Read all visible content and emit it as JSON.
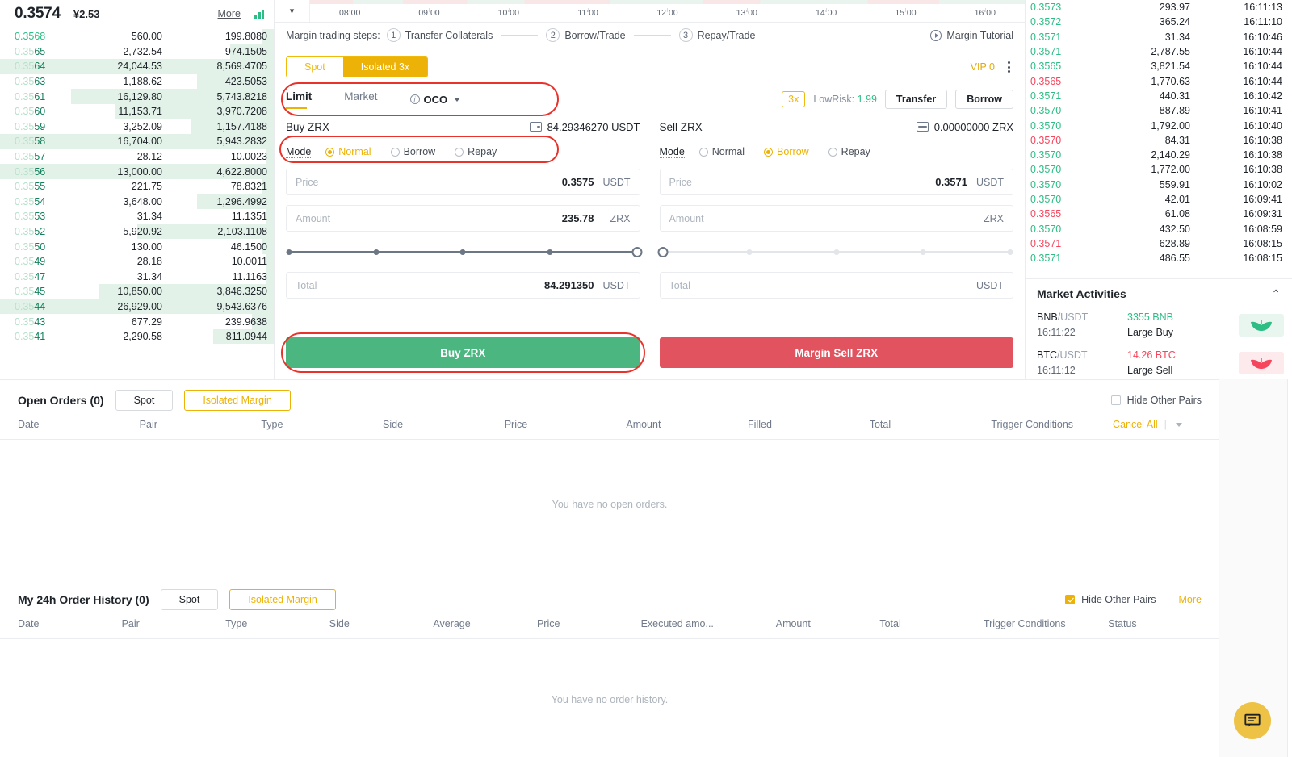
{
  "orderbook": {
    "last_price": "0.3574",
    "fiat_price": "¥2.53",
    "more_label": "More",
    "rows": [
      {
        "price": "0.3568",
        "sig": "",
        "amount": "560.00",
        "total": "199.8080",
        "bar": 4,
        "dim": false
      },
      {
        "price": "0.3565",
        "sig": "65",
        "amount": "2,732.54",
        "total": "974.1505",
        "bar": 16,
        "dim": true
      },
      {
        "price": "0.3564",
        "sig": "64",
        "amount": "24,044.53",
        "total": "8,569.4705",
        "bar": 100,
        "dim": true
      },
      {
        "price": "0.3563",
        "sig": "63",
        "amount": "1,188.62",
        "total": "423.5053",
        "bar": 28,
        "dim": true
      },
      {
        "price": "0.3561",
        "sig": "61",
        "amount": "16,129.80",
        "total": "5,743.8218",
        "bar": 74,
        "dim": true
      },
      {
        "price": "0.3560",
        "sig": "60",
        "amount": "11,153.71",
        "total": "3,970.7208",
        "bar": 58,
        "dim": true
      },
      {
        "price": "0.3559",
        "sig": "59",
        "amount": "3,252.09",
        "total": "1,157.4188",
        "bar": 30,
        "dim": true
      },
      {
        "price": "0.3558",
        "sig": "58",
        "amount": "16,704.00",
        "total": "5,943.2832",
        "bar": 100,
        "dim": true
      },
      {
        "price": "0.3557",
        "sig": "57",
        "amount": "28.12",
        "total": "10.0023",
        "bar": 3,
        "dim": true
      },
      {
        "price": "0.3556",
        "sig": "56",
        "amount": "13,000.00",
        "total": "4,622.8000",
        "bar": 100,
        "dim": true
      },
      {
        "price": "0.3555",
        "sig": "55",
        "amount": "221.75",
        "total": "78.8321",
        "bar": 4,
        "dim": true
      },
      {
        "price": "0.3554",
        "sig": "54",
        "amount": "3,648.00",
        "total": "1,296.4992",
        "bar": 28,
        "dim": true
      },
      {
        "price": "0.3553",
        "sig": "53",
        "amount": "31.34",
        "total": "11.1351",
        "bar": 3,
        "dim": true
      },
      {
        "price": "0.3552",
        "sig": "52",
        "amount": "5,920.92",
        "total": "2,103.1108",
        "bar": 50,
        "dim": true
      },
      {
        "price": "0.3550",
        "sig": "50",
        "amount": "130.00",
        "total": "46.1500",
        "bar": 4,
        "dim": true
      },
      {
        "price": "0.3549",
        "sig": "49",
        "amount": "28.18",
        "total": "10.0011",
        "bar": 3,
        "dim": true
      },
      {
        "price": "0.3547",
        "sig": "47",
        "amount": "31.34",
        "total": "11.1163",
        "bar": 3,
        "dim": true
      },
      {
        "price": "0.3545",
        "sig": "45",
        "amount": "10,850.00",
        "total": "3,846.3250",
        "bar": 64,
        "dim": true
      },
      {
        "price": "0.3544",
        "sig": "44",
        "amount": "26,929.00",
        "total": "9,543.6376",
        "bar": 100,
        "dim": true
      },
      {
        "price": "0.3543",
        "sig": "43",
        "amount": "677.29",
        "total": "239.9638",
        "bar": 8,
        "dim": true
      },
      {
        "price": "0.3541",
        "sig": "41",
        "amount": "2,290.58",
        "total": "811.0944",
        "bar": 22,
        "dim": true
      }
    ]
  },
  "chart": {
    "ticks": [
      "08:00",
      "09:00",
      "10:00",
      "11:00",
      "12:00",
      "13:00",
      "14:00",
      "15:00",
      "16:00"
    ]
  },
  "steps": {
    "label": "Margin trading steps:",
    "items": [
      {
        "num": "1",
        "text": "Transfer Collaterals"
      },
      {
        "num": "2",
        "text": "Borrow/Trade"
      },
      {
        "num": "3",
        "text": "Repay/Trade"
      }
    ],
    "tutorial": "Margin Tutorial"
  },
  "market_mode": {
    "spot": "Spot",
    "isolated": "Isolated 3x",
    "vip": "VIP 0"
  },
  "order_type": {
    "limit": "Limit",
    "market": "Market",
    "oco": "OCO",
    "leverage": "3x",
    "risk_label": "LowRisk:",
    "risk_value": "1.99",
    "transfer": "Transfer",
    "borrow": "Borrow"
  },
  "buy": {
    "title": "Buy ZRX",
    "balance": "84.29346270 USDT",
    "mode_label": "Mode",
    "modes": [
      {
        "label": "Normal",
        "selected": true
      },
      {
        "label": "Borrow",
        "selected": false
      },
      {
        "label": "Repay",
        "selected": false
      }
    ],
    "price_placeholder": "Price",
    "price_value": "0.3575",
    "price_unit": "USDT",
    "amount_placeholder": "Amount",
    "amount_value": "235.78",
    "amount_unit": "ZRX",
    "total_placeholder": "Total",
    "total_value": "84.291350",
    "total_unit": "USDT",
    "slider_percent": 100,
    "submit": "Buy ZRX"
  },
  "sell": {
    "title": "Sell ZRX",
    "balance": "0.00000000 ZRX",
    "mode_label": "Mode",
    "modes": [
      {
        "label": "Normal",
        "selected": false
      },
      {
        "label": "Borrow",
        "selected": true
      },
      {
        "label": "Repay",
        "selected": false
      }
    ],
    "price_placeholder": "Price",
    "price_value": "0.3571",
    "price_unit": "USDT",
    "amount_placeholder": "Amount",
    "amount_value": "",
    "amount_unit": "ZRX",
    "total_placeholder": "Total",
    "total_value": "",
    "total_unit": "USDT",
    "slider_percent": 0,
    "submit": "Margin Sell ZRX"
  },
  "trades": [
    {
      "price": "0.3573",
      "dir": "up",
      "amount": "293.97",
      "time": "16:11:13"
    },
    {
      "price": "0.3572",
      "dir": "up",
      "amount": "365.24",
      "time": "16:11:10"
    },
    {
      "price": "0.3571",
      "dir": "up",
      "amount": "31.34",
      "time": "16:10:46"
    },
    {
      "price": "0.3571",
      "dir": "up",
      "amount": "2,787.55",
      "time": "16:10:44"
    },
    {
      "price": "0.3565",
      "dir": "up",
      "amount": "3,821.54",
      "time": "16:10:44"
    },
    {
      "price": "0.3565",
      "dir": "down",
      "amount": "1,770.63",
      "time": "16:10:44"
    },
    {
      "price": "0.3571",
      "dir": "up",
      "amount": "440.31",
      "time": "16:10:42"
    },
    {
      "price": "0.3570",
      "dir": "up",
      "amount": "887.89",
      "time": "16:10:41"
    },
    {
      "price": "0.3570",
      "dir": "up",
      "amount": "1,792.00",
      "time": "16:10:40"
    },
    {
      "price": "0.3570",
      "dir": "down",
      "amount": "84.31",
      "time": "16:10:38"
    },
    {
      "price": "0.3570",
      "dir": "up",
      "amount": "2,140.29",
      "time": "16:10:38"
    },
    {
      "price": "0.3570",
      "dir": "up",
      "amount": "1,772.00",
      "time": "16:10:38"
    },
    {
      "price": "0.3570",
      "dir": "up",
      "amount": "559.91",
      "time": "16:10:02"
    },
    {
      "price": "0.3570",
      "dir": "up",
      "amount": "42.01",
      "time": "16:09:41"
    },
    {
      "price": "0.3565",
      "dir": "down",
      "amount": "61.08",
      "time": "16:09:31"
    },
    {
      "price": "0.3570",
      "dir": "up",
      "amount": "432.50",
      "time": "16:08:59"
    },
    {
      "price": "0.3571",
      "dir": "down",
      "amount": "628.89",
      "time": "16:08:15"
    },
    {
      "price": "0.3571",
      "dir": "up",
      "amount": "486.55",
      "time": "16:08:15"
    }
  ],
  "market_activities": {
    "title": "Market Activities",
    "rows": [
      {
        "base": "BNB",
        "quote": "/USDT",
        "time": "16:11:22",
        "amount": "3355 BNB",
        "kind": "Large Buy",
        "dir": "buy"
      },
      {
        "base": "BTC",
        "quote": "/USDT",
        "time": "16:11:12",
        "amount": "14.26 BTC",
        "kind": "Large Sell",
        "dir": "sell"
      }
    ]
  },
  "open_orders": {
    "title": "Open Orders (0)",
    "tabs": [
      {
        "label": "Spot",
        "selected": false
      },
      {
        "label": "Isolated Margin",
        "selected": true
      }
    ],
    "hide_other_pairs": "Hide Other Pairs",
    "hide_checked": false,
    "columns": [
      "Date",
      "Pair",
      "Type",
      "Side",
      "Price",
      "Amount",
      "Filled",
      "Total",
      "Trigger Conditions"
    ],
    "cancel_all": "Cancel All",
    "empty": "You have no open orders."
  },
  "order_history": {
    "title": "My 24h Order History (0)",
    "tabs": [
      {
        "label": "Spot",
        "selected": false
      },
      {
        "label": "Isolated Margin",
        "selected": true
      }
    ],
    "hide_other_pairs": "Hide Other Pairs",
    "hide_checked": true,
    "more": "More",
    "columns": [
      "Date",
      "Pair",
      "Type",
      "Side",
      "Average",
      "Price",
      "Executed amo...",
      "Amount",
      "Total",
      "Trigger Conditions",
      "Status"
    ],
    "empty": "You have no order history."
  },
  "colors": {
    "up": "#2ebd85",
    "down": "#f6465d",
    "accent": "#edb207",
    "highlight": "#e8322a"
  }
}
